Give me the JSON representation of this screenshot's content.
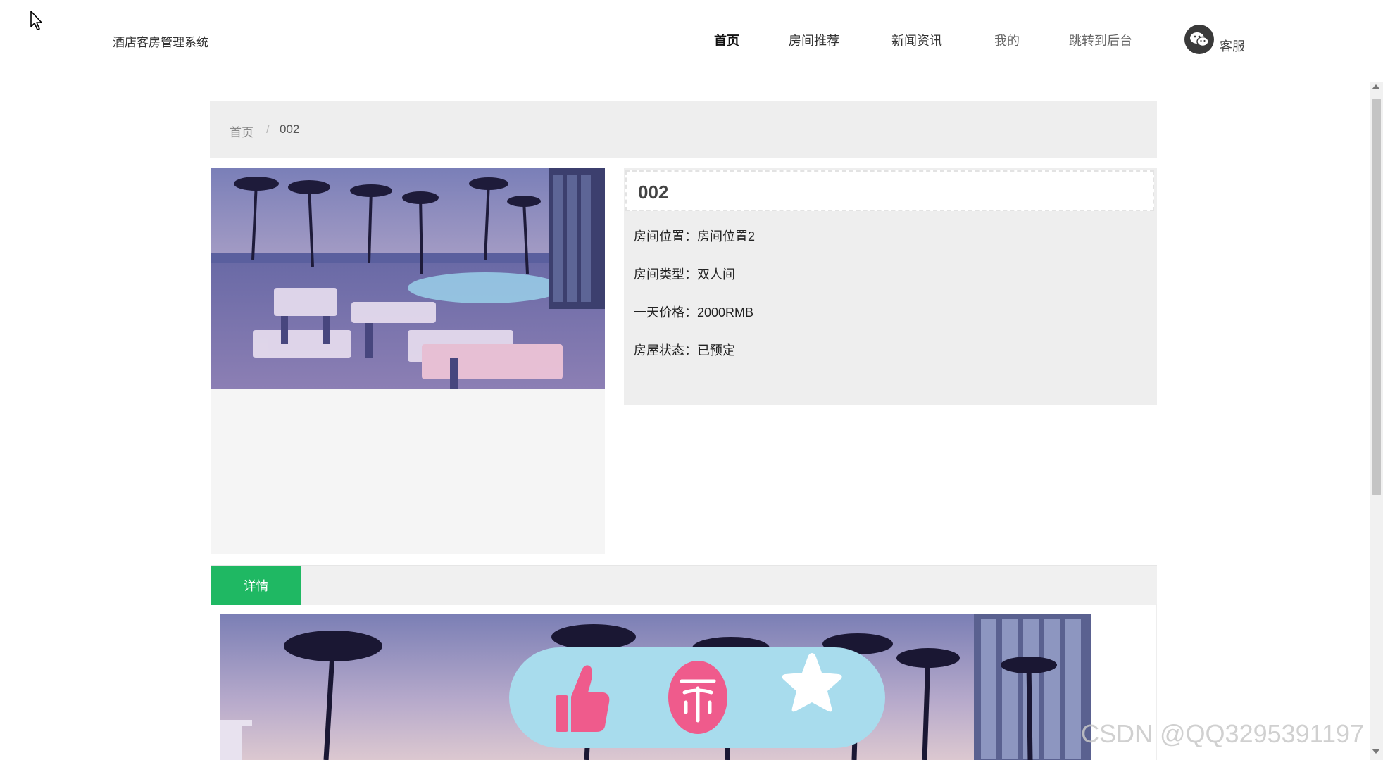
{
  "header": {
    "brand": "酒店客房管理系统",
    "nav": [
      {
        "label": "首页"
      },
      {
        "label": "房间推荐"
      },
      {
        "label": "新闻资讯"
      },
      {
        "label": "我的"
      },
      {
        "label": "跳转到后台"
      }
    ],
    "service_label": "客服"
  },
  "breadcrumb": {
    "home": "首页",
    "separator": "/",
    "current": "002"
  },
  "room": {
    "title": "002",
    "fields": [
      {
        "label": "房间位置：",
        "value": "房间位置2"
      },
      {
        "label": "房间类型：",
        "value": "双人间"
      },
      {
        "label": "一天价格：",
        "value": "2000RMB"
      },
      {
        "label": "房屋状态：",
        "value": "已预定"
      }
    ]
  },
  "detail_tab": {
    "label": "详情"
  },
  "actions": [
    {
      "icon": "thumbs-up-icon"
    },
    {
      "icon": "coin-icon"
    },
    {
      "icon": "star-icon"
    }
  ],
  "watermark": "CSDN @QQ3295391197",
  "colors": {
    "accent_green": "#1fb863",
    "pill_bg": "#a8dced",
    "pink": "#ef5b8c"
  }
}
